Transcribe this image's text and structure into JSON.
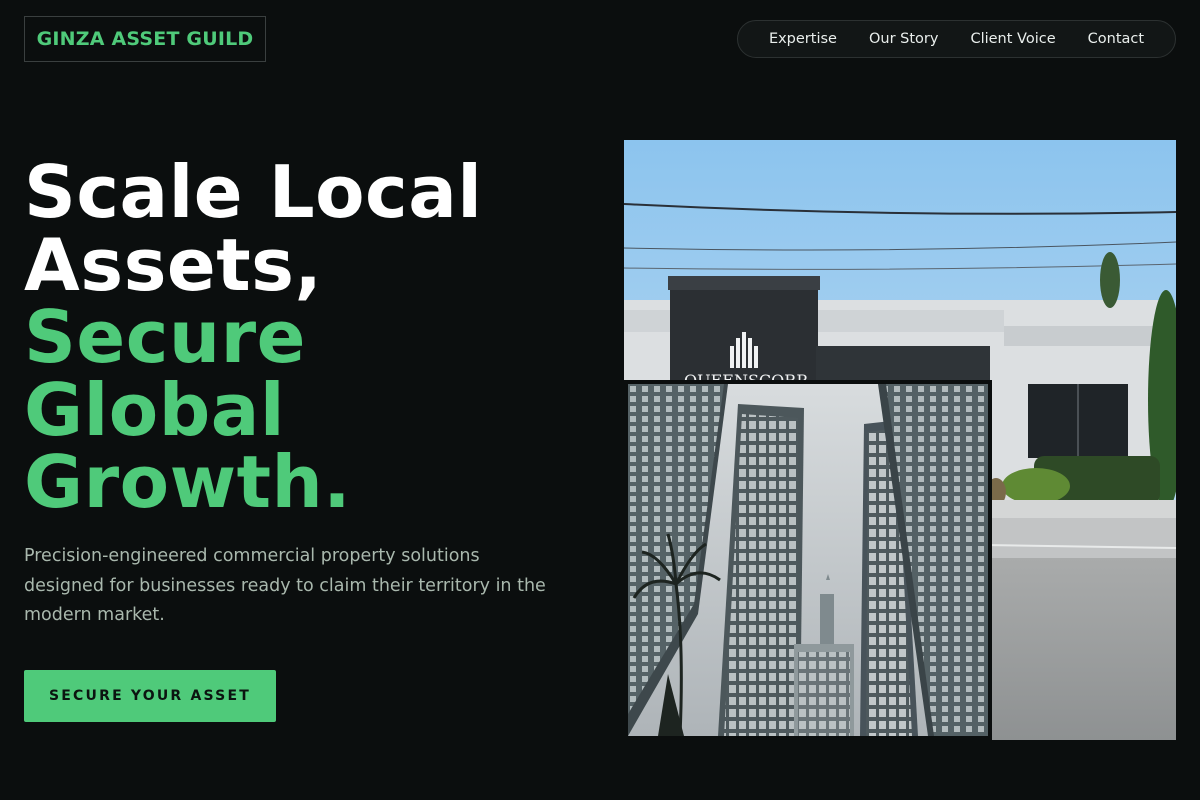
{
  "brand": {
    "name": "GINZA ASSET GUILD",
    "accent": "#4fca7a",
    "background": "#0b0e0e"
  },
  "nav": {
    "items": [
      {
        "label": "Expertise"
      },
      {
        "label": "Our Story"
      },
      {
        "label": "Client Voice"
      },
      {
        "label": "Contact"
      }
    ]
  },
  "hero": {
    "headline_white": [
      "Scale Local",
      "Assets,"
    ],
    "headline_green": [
      "Secure",
      "Global",
      "Growth."
    ],
    "subtext": "Precision-engineered commercial property solutions designed for businesses ready to claim their territory in the modern market.",
    "cta_label": "SECURE YOUR ASSET"
  },
  "images": {
    "back": {
      "building_sign": "QUEENSCORP"
    },
    "front": {}
  }
}
